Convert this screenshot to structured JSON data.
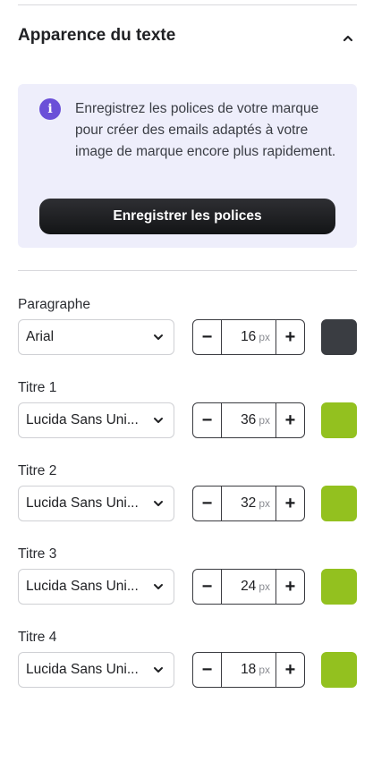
{
  "section": {
    "title": "Apparence du texte",
    "collapse_icon": "chevron-up-icon"
  },
  "info": {
    "icon": "info-icon",
    "icon_glyph": "i",
    "text": "Enregistrez les polices de votre marque pour créer des emails adaptés à votre image de marque encore plus rapidement.",
    "button_label": "Enregistrer les polices"
  },
  "rows": [
    {
      "label": "Paragraphe",
      "font": "Arial",
      "size": "16",
      "unit": "px",
      "color": "#3a3d42"
    },
    {
      "label": "Titre 1",
      "font": "Lucida Sans Uni...",
      "size": "36",
      "unit": "px",
      "color": "#93c11f"
    },
    {
      "label": "Titre 2",
      "font": "Lucida Sans Uni...",
      "size": "32",
      "unit": "px",
      "color": "#93c11f"
    },
    {
      "label": "Titre 3",
      "font": "Lucida Sans Uni...",
      "size": "24",
      "unit": "px",
      "color": "#93c11f"
    },
    {
      "label": "Titre 4",
      "font": "Lucida Sans Uni...",
      "size": "18",
      "unit": "px",
      "color": "#93c11f"
    }
  ],
  "stepper": {
    "minus": "−",
    "plus": "+"
  },
  "colors": {
    "accent": "#6a4fd8",
    "info_bg": "#eeeefb",
    "button_bg": "#1c1d20"
  }
}
